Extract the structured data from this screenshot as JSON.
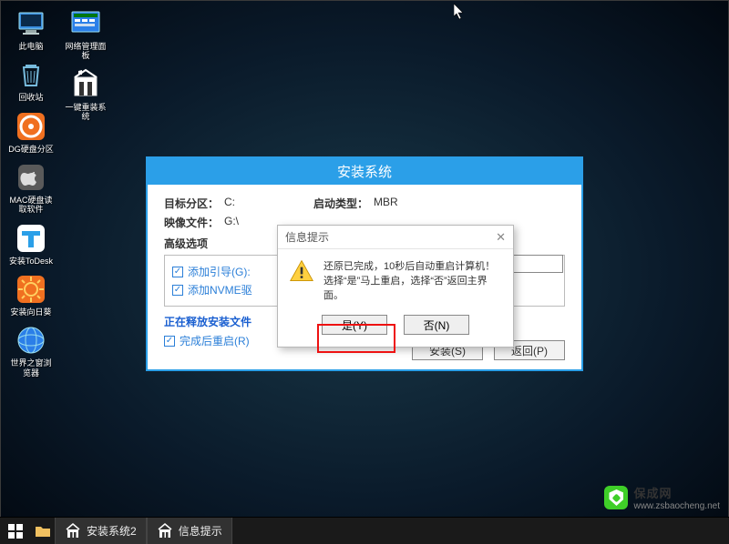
{
  "desktop": {
    "icons": [
      {
        "label": "此电脑",
        "name": "this-pc"
      },
      {
        "label": "网络管理面板",
        "name": "network-panel"
      },
      {
        "label": "回收站",
        "name": "recycle-bin"
      },
      {
        "label": "一键重装系统",
        "name": "one-click-reinstall"
      },
      {
        "label": "DG硬盘分区",
        "name": "dg-partition"
      },
      {
        "label": "MAC硬盘读取软件",
        "name": "mac-disk-reader"
      },
      {
        "label": "安装ToDesk",
        "name": "install-todesk"
      },
      {
        "label": "安装向日葵",
        "name": "install-sunlogin"
      },
      {
        "label": "世界之窗浏览器",
        "name": "world-browser"
      }
    ]
  },
  "installer": {
    "title": "安装系统",
    "target_label": "目标分区：",
    "target_value": "C:",
    "boot_label": "启动类型：",
    "boot_value": "MBR",
    "image_label": "映像文件：",
    "image_value": "G:\\",
    "adv_label": "高级选项",
    "opt1": "添加引导(G):",
    "opt2": "添加NVME驱",
    "progress": "正在释放安装文件",
    "after": "完成后重启(R)",
    "install_btn": "安装(S)",
    "back_btn": "返回(P)"
  },
  "dialog": {
    "title": "信息提示",
    "line1": "还原已完成，10秒后自动重启计算机！",
    "line2": "选择“是”马上重启，选择“否”返回主界面。",
    "yes": "是(Y)",
    "no": "否(N)"
  },
  "taskbar": {
    "items": [
      {
        "label": "安装系统2",
        "name": "task-install-system"
      },
      {
        "label": "信息提示",
        "name": "task-info-prompt"
      }
    ]
  },
  "watermark": {
    "brand": "保成网",
    "url": "www.zsbaocheng.net"
  }
}
